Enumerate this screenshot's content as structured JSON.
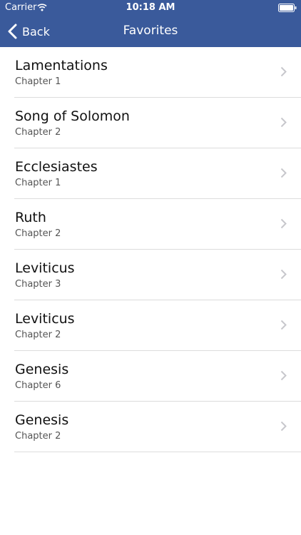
{
  "status_bar": {
    "carrier": "Carrier",
    "time": "10:18 AM"
  },
  "nav": {
    "back_label": "Back",
    "title": "Favorites"
  },
  "favorites": [
    {
      "title": "Lamentations",
      "subtitle": "Chapter 1"
    },
    {
      "title": "Song of Solomon",
      "subtitle": "Chapter 2"
    },
    {
      "title": "Ecclesiastes",
      "subtitle": "Chapter 1"
    },
    {
      "title": "Ruth",
      "subtitle": "Chapter 2"
    },
    {
      "title": "Leviticus",
      "subtitle": "Chapter 3"
    },
    {
      "title": "Leviticus",
      "subtitle": "Chapter 2"
    },
    {
      "title": "Genesis",
      "subtitle": "Chapter 6"
    },
    {
      "title": "Genesis",
      "subtitle": "Chapter 2"
    }
  ],
  "colors": {
    "header_background": "#3a5a9b",
    "header_text": "#ffffff",
    "separator": "#dcdcdc"
  },
  "icons": {
    "wifi": "wifi-icon",
    "battery": "battery-icon",
    "back": "chevron-left-icon",
    "row_disclosure": "chevron-right-icon"
  }
}
